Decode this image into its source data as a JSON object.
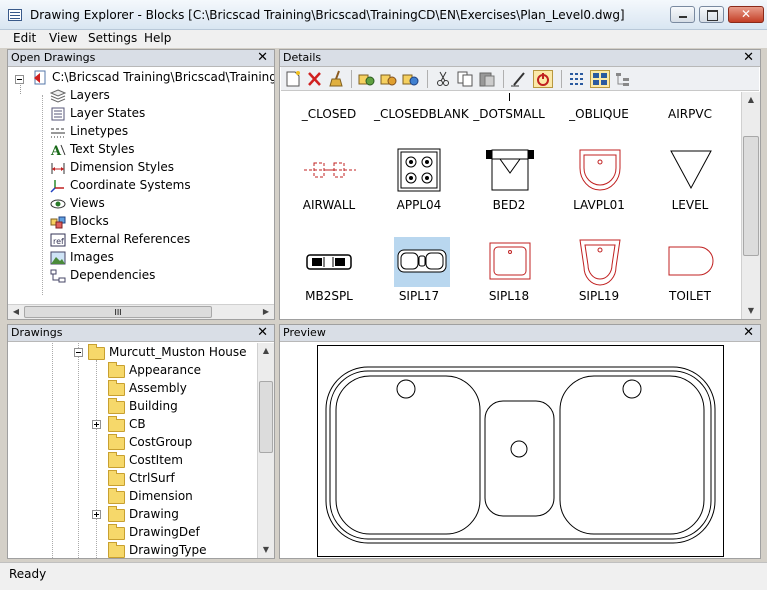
{
  "window": {
    "title": "Drawing Explorer - Blocks [C:\\Bricscad Training\\Bricscad\\TrainingCD\\EN\\Exercises\\Plan_Level0.dwg]"
  },
  "menu": [
    "Edit",
    "View",
    "Settings",
    "Help"
  ],
  "open_drawings": {
    "title": "Open Drawings",
    "root": "C:\\Bricscad Training\\Bricscad\\TrainingCD\\",
    "items": [
      {
        "label": "Layers",
        "icon": "layers-icon"
      },
      {
        "label": "Layer States",
        "icon": "layer-states-icon"
      },
      {
        "label": "Linetypes",
        "icon": "linetypes-icon"
      },
      {
        "label": "Text Styles",
        "icon": "text-styles-icon"
      },
      {
        "label": "Dimension Styles",
        "icon": "dimension-styles-icon"
      },
      {
        "label": "Coordinate Systems",
        "icon": "coordinate-systems-icon"
      },
      {
        "label": "Views",
        "icon": "views-icon"
      },
      {
        "label": "Blocks",
        "icon": "blocks-icon"
      },
      {
        "label": "External References",
        "icon": "external-references-icon"
      },
      {
        "label": "Images",
        "icon": "images-icon"
      },
      {
        "label": "Dependencies",
        "icon": "dependencies-icon"
      }
    ],
    "scroll_marker": "III"
  },
  "details": {
    "title": "Details",
    "header_row": [
      "_CLOSED",
      "_CLOSEDBLANK",
      "_DOTSMALL",
      "_OBLIQUE",
      "AIRPVC"
    ],
    "row1": [
      "AIRWALL",
      "APPL04",
      "BED2",
      "LAVPL01",
      "LEVEL"
    ],
    "row2": [
      "MB2SPL",
      "SIPL17",
      "SIPL18",
      "SIPL19",
      "TOILET"
    ],
    "selected": "SIPL17"
  },
  "drawings": {
    "title": "Drawings",
    "root": "Murcutt_Muston House",
    "items": [
      {
        "label": "Appearance",
        "expandable": false
      },
      {
        "label": "Assembly",
        "expandable": false
      },
      {
        "label": "Building",
        "expandable": false
      },
      {
        "label": "CB",
        "expandable": true
      },
      {
        "label": "CostGroup",
        "expandable": false
      },
      {
        "label": "CostItem",
        "expandable": false
      },
      {
        "label": "CtrlSurf",
        "expandable": false
      },
      {
        "label": "Dimension",
        "expandable": false
      },
      {
        "label": "Drawing",
        "expandable": true
      },
      {
        "label": "DrawingDef",
        "expandable": false
      },
      {
        "label": "DrawingType",
        "expandable": false
      }
    ]
  },
  "preview": {
    "title": "Preview"
  },
  "status": "Ready"
}
